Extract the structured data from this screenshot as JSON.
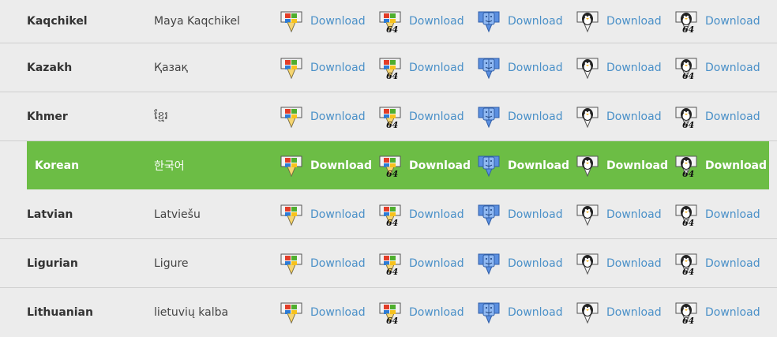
{
  "download_label": "Download",
  "icons": [
    "windows-download-icon",
    "windows-64-download-icon",
    "mac-download-icon",
    "linux-download-icon",
    "linux-64-download-icon"
  ],
  "badge_64": "64",
  "colors": {
    "highlight": "#6cbd45",
    "link": "#4a90c8",
    "background": "#ececec"
  },
  "rows": [
    {
      "language": "Kaqchikel",
      "native": "Maya Kaqchikel"
    },
    {
      "language": "Kazakh",
      "native": "Қазақ"
    },
    {
      "language": "Khmer",
      "native": "ខ្មែរ"
    },
    {
      "language": "Korean",
      "native": "한국어",
      "highlighted": true
    },
    {
      "language": "Latvian",
      "native": "Latviešu"
    },
    {
      "language": "Ligurian",
      "native": "Ligure"
    },
    {
      "language": "Lithuanian",
      "native": "lietuvių kalba"
    }
  ]
}
